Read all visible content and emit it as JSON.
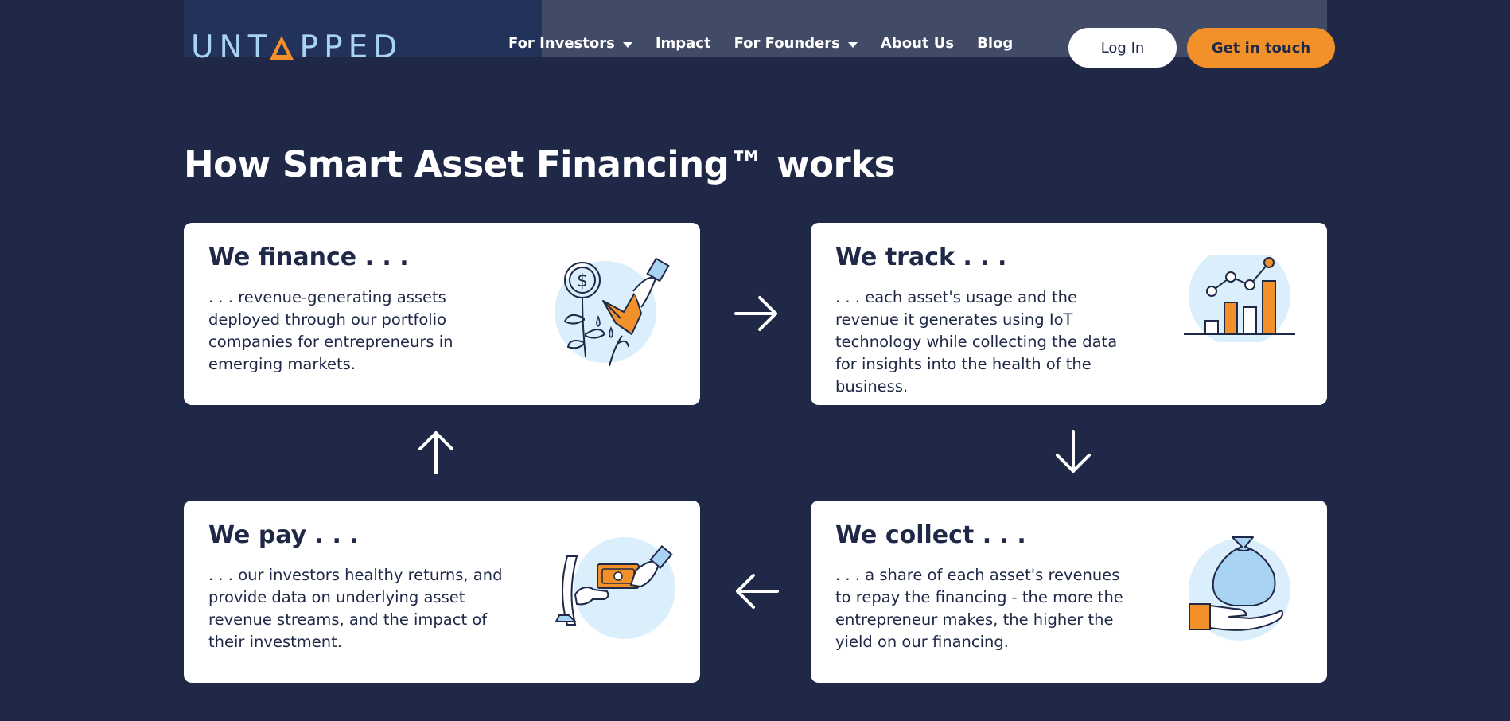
{
  "brand": {
    "logo_text": "UNTAPPED",
    "colors": {
      "navy": "#1f2847",
      "orange": "#f2912a",
      "light_blue": "#a9d3f2",
      "pale_blue": "#dbeefc"
    }
  },
  "nav": {
    "items": [
      {
        "label": "For Investors",
        "has_dropdown": true
      },
      {
        "label": "Impact",
        "has_dropdown": false
      },
      {
        "label": "For Founders",
        "has_dropdown": true
      },
      {
        "label": "About Us",
        "has_dropdown": false
      },
      {
        "label": "Blog",
        "has_dropdown": false
      }
    ],
    "login_label": "Log In",
    "cta_label": "Get in touch"
  },
  "section": {
    "title": "How Smart Asset Financing™ works",
    "cards": [
      {
        "heading": "We finance . . .",
        "body": ". . . revenue-generating assets deployed through our portfolio companies for entrepreneurs in emerging markets.",
        "icon": "watering-plant-icon"
      },
      {
        "heading": "We track . . .",
        "body": ". . . each asset's usage and the revenue it generates using IoT technology while collecting the data for insights into the health of the business.",
        "icon": "bar-chart-icon"
      },
      {
        "heading": "We pay . . .",
        "body": ". . . our investors healthy returns, and provide data on underlying asset revenue streams, and the impact of their investment.",
        "icon": "payment-hand-icon"
      },
      {
        "heading": "We collect . . .",
        "body": ". . . a share of each asset's revenues to repay the financing - the more the entrepreneur makes, the higher the yield on our financing.",
        "icon": "money-bag-hand-icon"
      }
    ],
    "arrows": [
      "arrow-right-icon",
      "arrow-down-icon",
      "arrow-left-icon",
      "arrow-up-icon"
    ]
  }
}
